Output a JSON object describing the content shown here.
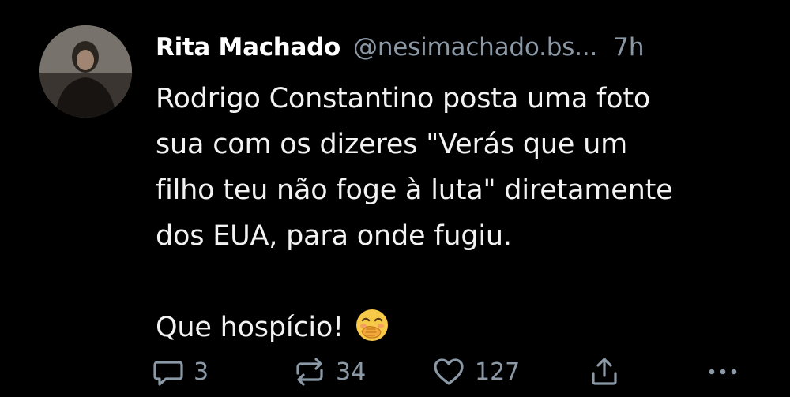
{
  "post": {
    "author": {
      "display_name": "Rita Machado",
      "handle": "@nesimachado.bs...",
      "avatar": "profile-photo"
    },
    "timestamp": "7h",
    "text_lines": [
      "Rodrigo Constantino posta uma foto",
      "sua com os dizeres \"Verás que um",
      "filho teu não foge à luta\" diretamente",
      "dos EUA, para onde fugiu."
    ],
    "closing_line": "Que hospício!",
    "closing_emoji": "face-with-hand-over-mouth-emoji",
    "actions": {
      "reply": {
        "icon": "reply-icon",
        "count": "3"
      },
      "repost": {
        "icon": "repost-icon",
        "count": "34"
      },
      "like": {
        "icon": "heart-icon",
        "count": "127"
      },
      "share": {
        "icon": "share-icon"
      },
      "more": {
        "icon": "more-icon"
      }
    }
  },
  "colors": {
    "background": "#000000",
    "text": "#f2f2f2",
    "muted": "#8b98a5",
    "emoji": "#f7c948"
  }
}
